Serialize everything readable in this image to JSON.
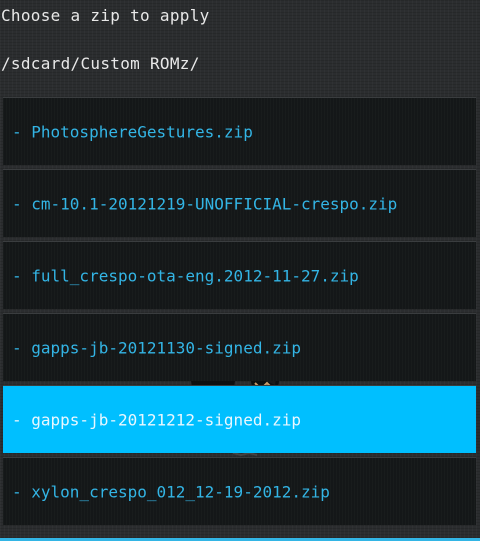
{
  "header": {
    "title": "Choose a zip to apply",
    "path": "/sdcard/Custom ROMz/"
  },
  "files": [
    {
      "label": "- PhotosphereGestures.zip",
      "selected": false
    },
    {
      "label": "- cm-10.1-20121219-UNOFFICIAL-crespo.zip",
      "selected": false
    },
    {
      "label": "- full_crespo-ota-eng.2012-11-27.zip",
      "selected": false
    },
    {
      "label": "- gapps-jb-20121130-signed.zip",
      "selected": false
    },
    {
      "label": "- gapps-jb-20121212-signed.zip",
      "selected": true
    },
    {
      "label": "- xylon_crespo_012_12-19-2012.zip",
      "selected": false
    }
  ],
  "colors": {
    "accent": "#33b5e5",
    "selected_bg": "#00bfff",
    "item_bg": "#141718",
    "background": "#2b2d2f"
  },
  "icons": {
    "background_mascot": "recovery-mascot-icon"
  }
}
